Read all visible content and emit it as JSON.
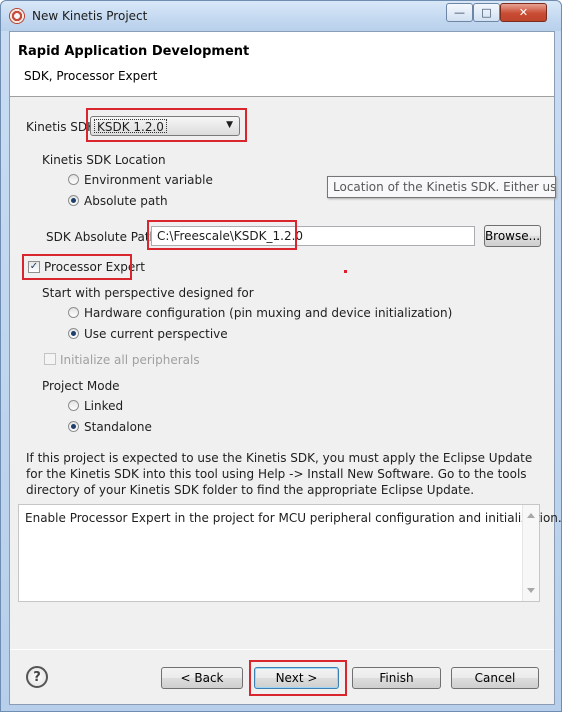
{
  "window": {
    "title": "New Kinetis Project"
  },
  "header": {
    "title": "Rapid Application Development",
    "subtitle": "SDK, Processor Expert"
  },
  "sdk": {
    "label": "Kinetis SDK",
    "selected": "KSDK 1.2.0"
  },
  "sdk_location": {
    "label": "Kinetis SDK Location",
    "options": [
      "Environment variable",
      "Absolute path"
    ],
    "selected": "Absolute path"
  },
  "tooltip": {
    "text": "Location of the Kinetis SDK. Either use the sy"
  },
  "sdk_path": {
    "label": "SDK Absolute Path",
    "value": "C:\\Freescale\\KSDK_1.2.0",
    "browse_label": "Browse..."
  },
  "processor_expert": {
    "label": "Processor Expert",
    "checked": true
  },
  "perspective": {
    "label": "Start with perspective designed for",
    "options": [
      "Hardware configuration (pin muxing and device initialization)",
      "Use current perspective"
    ],
    "selected": "Use current perspective"
  },
  "init_peripherals": {
    "label": "Initialize all peripherals",
    "enabled": false
  },
  "project_mode": {
    "label": "Project Mode",
    "options": [
      "Linked",
      "Standalone"
    ],
    "selected": "Standalone"
  },
  "info": {
    "text": "If this project is expected to use the Kinetis SDK, you must apply the Eclipse Update for the Kinetis SDK into this tool using Help -> Install New Software. Go to the tools directory of your Kinetis SDK folder to find the appropriate Eclipse Update."
  },
  "description": {
    "text": "Enable Processor Expert in the project for MCU peripheral configuration and initialization."
  },
  "buttons": {
    "back": "< Back",
    "next": "Next >",
    "finish": "Finish",
    "cancel": "Cancel",
    "help": "?"
  },
  "colors": {
    "highlight": "#d9262e",
    "accent": "#1e3f6b"
  }
}
